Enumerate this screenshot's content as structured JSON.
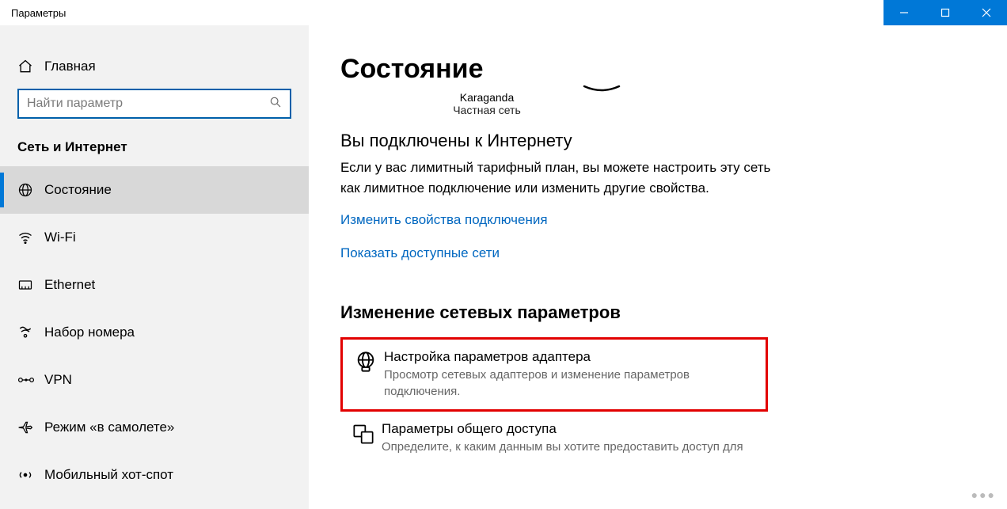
{
  "window": {
    "title": "Параметры"
  },
  "sidebar": {
    "home": "Главная",
    "search_placeholder": "Найти параметр",
    "section": "Сеть и Интернет",
    "items": [
      {
        "label": "Состояние"
      },
      {
        "label": "Wi-Fi"
      },
      {
        "label": "Ethernet"
      },
      {
        "label": "Набор номера"
      },
      {
        "label": "VPN"
      },
      {
        "label": "Режим «в самолете»"
      },
      {
        "label": "Мобильный хот-спот"
      }
    ]
  },
  "content": {
    "title": "Состояние",
    "network_name": "Karaganda",
    "network_type": "Частная сеть",
    "connected_heading": "Вы подключены к Интернету",
    "connected_desc": "Если у вас лимитный тарифный план, вы можете настроить эту сеть как лимитное подключение или изменить другие свойства.",
    "link_props": "Изменить свойства подключения",
    "link_networks": "Показать доступные сети",
    "change_heading": "Изменение сетевых параметров",
    "option1_title": "Настройка параметров адаптера",
    "option1_desc": "Просмотр сетевых адаптеров и изменение параметров подключения.",
    "option2_title": "Параметры общего доступа",
    "option2_desc": "Определите, к каким данным вы хотите предоставить доступ для"
  }
}
